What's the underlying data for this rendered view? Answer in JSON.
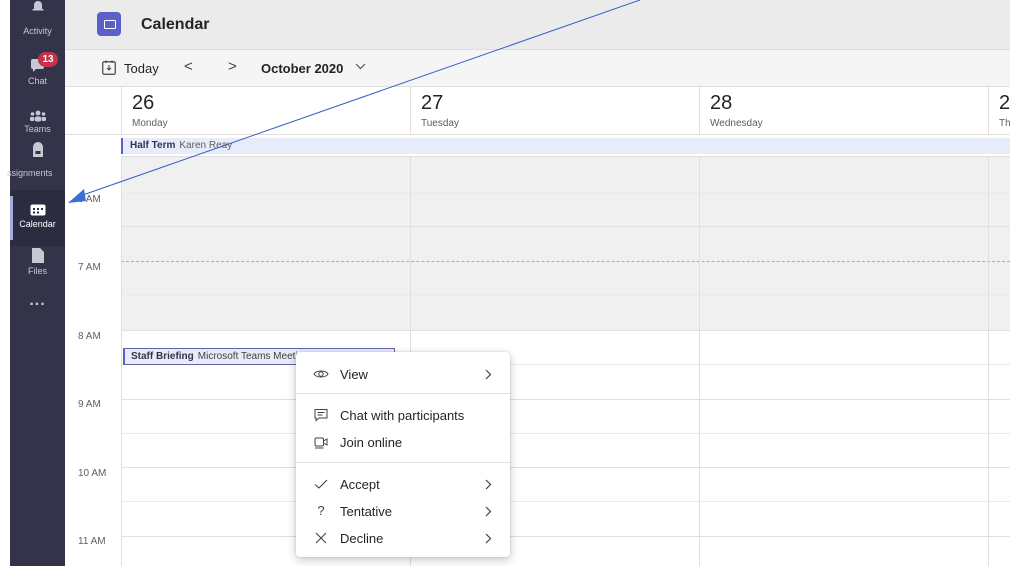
{
  "rail": {
    "activity": "Activity",
    "chat": "Chat",
    "chat_badge": "13",
    "teams": "Teams",
    "assignments": "ssignments",
    "calendar": "Calendar",
    "files": "Files",
    "more": "..."
  },
  "header": {
    "title": "Calendar"
  },
  "toolbar": {
    "today": "Today",
    "prev": "<",
    "next": ">",
    "month": "October 2020"
  },
  "days": [
    {
      "num": "26",
      "name": "Monday"
    },
    {
      "num": "27",
      "name": "Tuesday"
    },
    {
      "num": "28",
      "name": "Wednesday"
    },
    {
      "num": "2",
      "name": "Th"
    }
  ],
  "all_day_event": {
    "title": "Half Term",
    "organizer": "Karen Reay"
  },
  "time_labels": [
    "6 AM",
    "7 AM",
    "8 AM",
    "9 AM",
    "10 AM",
    "11 AM"
  ],
  "event": {
    "title": "Staff Briefing",
    "location": "Microsoft Teams Meeting"
  },
  "context_menu": {
    "view": "View",
    "chat_with_participants": "Chat with participants",
    "join_online": "Join online",
    "accept": "Accept",
    "tentative": "Tentative",
    "decline": "Decline"
  },
  "colors": {
    "rail": "#33344a",
    "accent": "#5b5fc7",
    "badge": "#c4314b",
    "annotation_arrow": "#2f5fbf"
  }
}
